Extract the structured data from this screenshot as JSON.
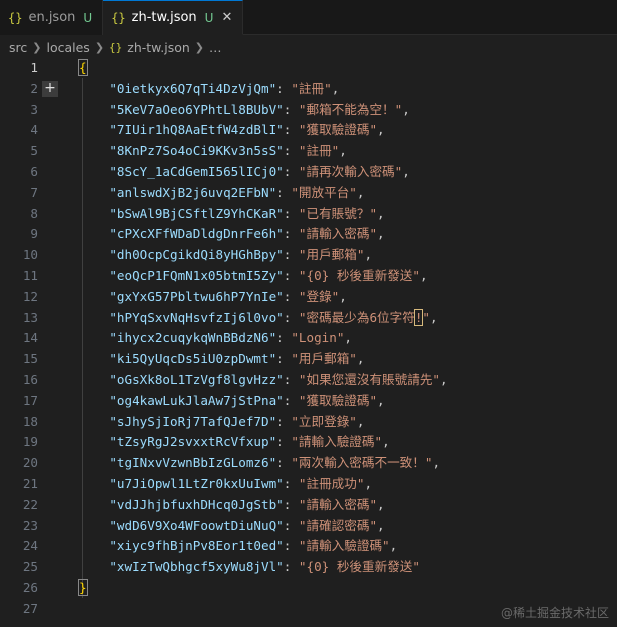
{
  "tabs": [
    {
      "icon": "{}",
      "label": "en.json",
      "status": "U",
      "active": false
    },
    {
      "icon": "{}",
      "label": "zh-tw.json",
      "status": "U",
      "active": true,
      "close": "✕"
    }
  ],
  "breadcrumb": {
    "parts": [
      "src",
      "locales"
    ],
    "file_icon": "{}",
    "file": "zh-tw.json",
    "ellipsis": "…"
  },
  "editor": {
    "open_brace": "{",
    "close_brace": "}",
    "entries": [
      {
        "line": 2,
        "key": "\"0ietkyx6Q7qTi4DzVjQm\"",
        "value": "\"註冊\""
      },
      {
        "line": 3,
        "key": "\"5KeV7aOeo6YPhtLl8BUbV\"",
        "value": "\"郵箱不能為空！\""
      },
      {
        "line": 4,
        "key": "\"7IUir1hQ8AaEtfW4zdBlI\"",
        "value": "\"獲取驗證碼\""
      },
      {
        "line": 5,
        "key": "\"8KnPz7So4oCi9KKv3n5sS\"",
        "value": "\"註冊\""
      },
      {
        "line": 6,
        "key": "\"8ScY_1aCdGemI565lICj0\"",
        "value": "\"請再次輸入密碼\""
      },
      {
        "line": 7,
        "key": "\"anlswdXjB2j6uvq2EFbN\"",
        "value": "\"開放平台\""
      },
      {
        "line": 8,
        "key": "\"bSwAl9BjCSftlZ9YhCKaR\"",
        "value": "\"已有賬號？\""
      },
      {
        "line": 9,
        "key": "\"cPXcXFfWDaDldgDnrFe6h\"",
        "value": "\"請輸入密碼\""
      },
      {
        "line": 10,
        "key": "\"dh0OcpCgikdQi8yHGhBpy\"",
        "value": "\"用戶郵箱\""
      },
      {
        "line": 11,
        "key": "\"eoQcP1FQmN1x05btmI5Zy\"",
        "value": "\"{0} 秒後重新發送\""
      },
      {
        "line": 12,
        "key": "\"gxYxG57Pbltwu6hP7YnIe\"",
        "value": "\"登錄\""
      },
      {
        "line": 13,
        "key": "\"hPYqSxvNqHsvfzIj6l0vo\"",
        "value_pre": "\"密碼最少為6位字符",
        "value_highlight": "!",
        "value_post": "\""
      },
      {
        "line": 14,
        "key": "\"ihycx2cuqykqWnBBdzN6\"",
        "value": "\"Login\""
      },
      {
        "line": 15,
        "key": "\"ki5QyUqcDs5iU0zpDwmt\"",
        "value": "\"用戶郵箱\""
      },
      {
        "line": 16,
        "key": "\"oGsXk8oL1TzVgf8lgvHzz\"",
        "value": "\"如果您還沒有賬號請先\""
      },
      {
        "line": 17,
        "key": "\"og4kawLukJlaAw7jStPna\"",
        "value": "\"獲取驗證碼\""
      },
      {
        "line": 18,
        "key": "\"sJhySjIoRj7TafQJef7D\"",
        "value": "\"立即登錄\""
      },
      {
        "line": 19,
        "key": "\"tZsyRgJ2svxxtRcVfxup\"",
        "value": "\"請輸入驗證碼\""
      },
      {
        "line": 20,
        "key": "\"tgINxvVzwnBbIzGLomz6\"",
        "value": "\"兩次輸入密碼不一致！\""
      },
      {
        "line": 21,
        "key": "\"u7JiOpwl1LtZr0kxUuIwm\"",
        "value": "\"註冊成功\""
      },
      {
        "line": 22,
        "key": "\"vdJJhjbfuxhDHcq0JgStb\"",
        "value": "\"請輸入密碼\""
      },
      {
        "line": 23,
        "key": "\"wdD6V9Xo4WFoowtDiuNuQ\"",
        "value": "\"請確認密碼\""
      },
      {
        "line": 24,
        "key": "\"xiyc9fhBjnPv8Eor1t0ed\"",
        "value": "\"請輸入驗證碼\""
      },
      {
        "line": 25,
        "key": "\"xwIzTwQbhgcf5xyWu8jVl\"",
        "value": "\"{0} 秒後重新發送\"",
        "last": true
      }
    ],
    "line_numbers": [
      "1",
      "2",
      "3",
      "4",
      "5",
      "6",
      "7",
      "8",
      "9",
      "10",
      "11",
      "12",
      "13",
      "14",
      "15",
      "16",
      "17",
      "18",
      "19",
      "20",
      "21",
      "22",
      "23",
      "24",
      "25",
      "26",
      "27"
    ],
    "fold_icon": "+"
  },
  "watermark": "@稀土掘金技术社区",
  "colors": {
    "background": "#1f1f1f",
    "key": "#9cdcfe",
    "string": "#ce9178",
    "brace": "#ffd700",
    "untracked": "#73c991"
  }
}
